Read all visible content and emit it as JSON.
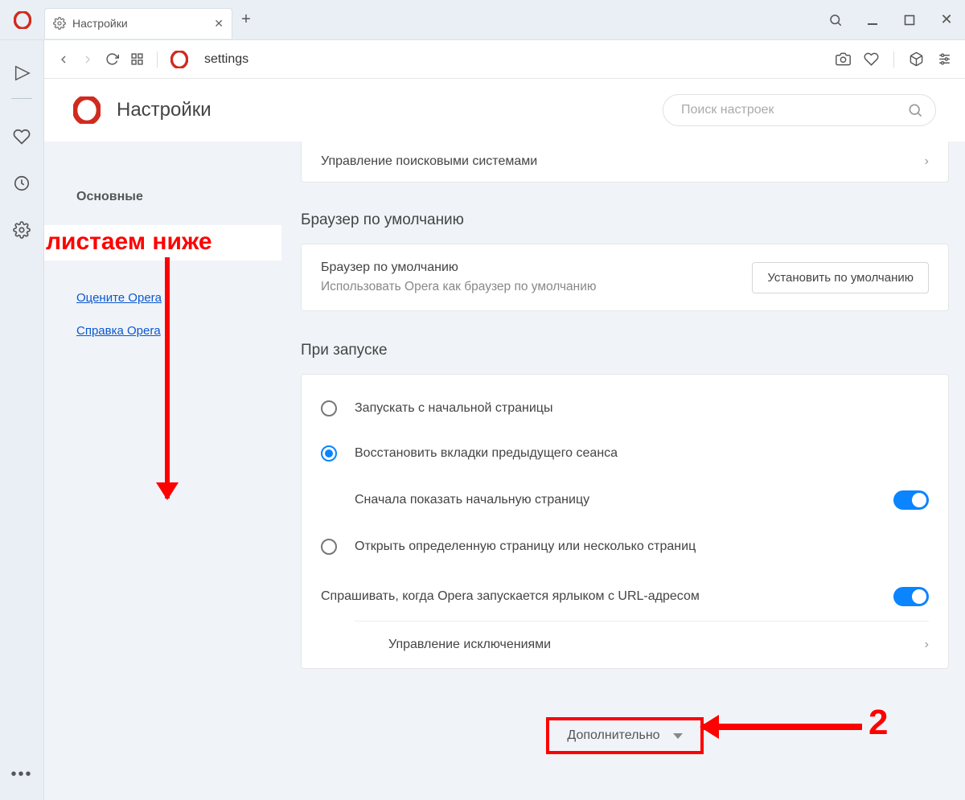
{
  "titlebar": {
    "tab_title": "Настройки",
    "new_tab_label": "+"
  },
  "addressbar": {
    "url_text": "settings"
  },
  "header": {
    "title": "Настройки",
    "search_placeholder": "Поиск настроек"
  },
  "sidebar": {
    "main_label": "Основные",
    "rate_label": "Оцените Opera",
    "help_label": "Справка Opera"
  },
  "sections": {
    "search_engines_row": "Управление поисковыми системами",
    "default_browser_title": "Браузер по умолчанию",
    "default_browser_row1": "Браузер по умолчанию",
    "default_browser_row2": "Использовать Opera как браузер по умолчанию",
    "set_default_btn": "Установить по умолчанию",
    "startup_title": "При запуске",
    "startup_opt1": "Запускать с начальной страницы",
    "startup_opt2": "Восстановить вкладки предыдущего сеанса",
    "startup_opt2_sub": "Сначала показать начальную страницу",
    "startup_opt3": "Открыть определенную страницу или несколько страниц",
    "ask_launch": "Спрашивать, когда Opera запускается ярлыком с URL-адресом",
    "exceptions": "Управление исключениями",
    "advanced": "Дополнительно"
  },
  "annotations": {
    "scroll_down": "листаем ниже",
    "step2": "2"
  }
}
